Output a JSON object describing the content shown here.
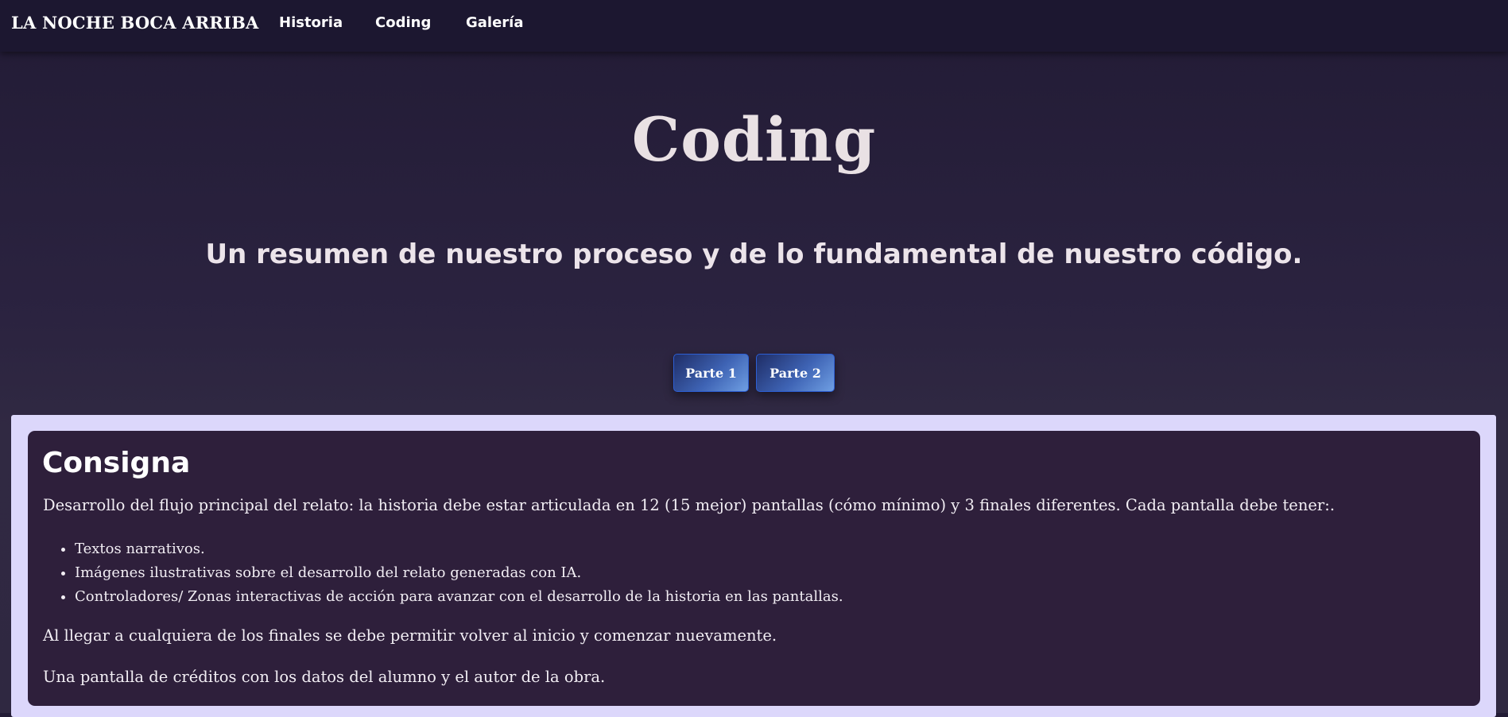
{
  "navbar": {
    "brand": "LA NOCHE BOCA ARRIBA",
    "links": [
      "Historia",
      "Coding",
      "Galería"
    ]
  },
  "hero": {
    "title": "Coding",
    "subtitle": "Un resumen de nuestro proceso y de lo fundamental de nuestro código."
  },
  "tabs": [
    "Parte 1",
    "Parte 2"
  ],
  "section": {
    "title": "Consigna",
    "intro": "Desarrollo del flujo principal del relato: la historia debe estar articulada en 12 (15 mejor) pantallas (cómo mínimo) y 3 finales diferentes. Cada pantalla debe tener:.",
    "items": [
      "Textos narrativos.",
      "Imágenes ilustrativas sobre el desarrollo del relato generadas con IA.",
      "Controladores/ Zonas interactivas de acción para avanzar con el desarrollo de la historia en las pantallas."
    ],
    "paragraph_2": "Al llegar a cualquiera de los finales se debe permitir volver al inicio y comenzar nuevamente.",
    "paragraph_3": "Una pantalla de créditos con los datos del alumno y el autor de la obra."
  },
  "colors": {
    "navbar_bg": "#1c1730",
    "panel_bg": "#dcd7fb",
    "card_bg": "#2e1f3b",
    "button_accent": "#3e63b4"
  }
}
